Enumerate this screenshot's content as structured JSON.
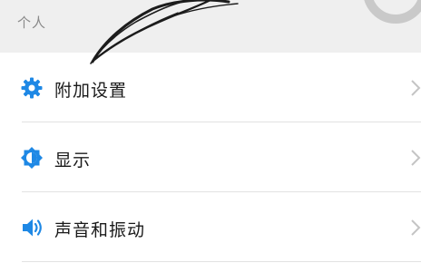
{
  "section": {
    "title": "个人"
  },
  "items": [
    {
      "label": "附加设置",
      "icon": "gear-icon"
    },
    {
      "label": "显示",
      "icon": "brightness-icon"
    },
    {
      "label": "声音和振动",
      "icon": "speaker-icon"
    }
  ],
  "colors": {
    "accent": "#1e88e5",
    "header_bg": "#efefef",
    "divider": "#e2e2e2",
    "chevron": "#c4c4c4"
  }
}
